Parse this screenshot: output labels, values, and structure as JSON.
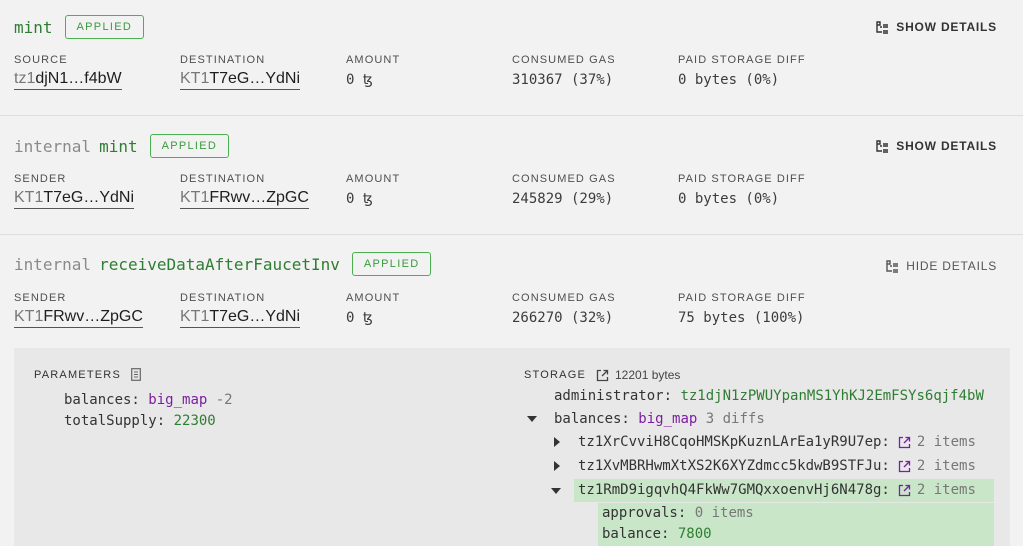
{
  "ops": [
    {
      "internal": "",
      "entrypoint": "mint",
      "status": "APPLIED",
      "toggle": "SHOW DETAILS",
      "from_label": "SOURCE",
      "from_prefix": "tz1",
      "from_addr": "djN1…f4bW",
      "to_label": "DESTINATION",
      "to_prefix": "KT1",
      "to_addr": "T7eG…YdNi",
      "amount_label": "AMOUNT",
      "amount": "0 ꜩ",
      "gas_label": "CONSUMED GAS",
      "gas": "310367 (37%)",
      "storage_label": "PAID STORAGE DIFF",
      "storage": "0 bytes (0%)"
    },
    {
      "internal": "internal",
      "entrypoint": "mint",
      "status": "APPLIED",
      "toggle": "SHOW DETAILS",
      "from_label": "SENDER",
      "from_prefix": "KT1",
      "from_addr": "T7eG…YdNi",
      "to_label": "DESTINATION",
      "to_prefix": "KT1",
      "to_addr": "FRwv…ZpGC",
      "amount_label": "AMOUNT",
      "amount": "0 ꜩ",
      "gas_label": "CONSUMED GAS",
      "gas": "245829 (29%)",
      "storage_label": "PAID STORAGE DIFF",
      "storage": "0 bytes (0%)"
    },
    {
      "internal": "internal",
      "entrypoint": "receiveDataAfterFaucetInv",
      "status": "APPLIED",
      "toggle": "HIDE DETAILS",
      "from_label": "SENDER",
      "from_prefix": "KT1",
      "from_addr": "FRwv…ZpGC",
      "to_label": "DESTINATION",
      "to_prefix": "KT1",
      "to_addr": "T7eG…YdNi",
      "amount_label": "AMOUNT",
      "amount": "0 ꜩ",
      "gas_label": "CONSUMED GAS",
      "gas": "266270 (32%)",
      "storage_label": "PAID STORAGE DIFF",
      "storage": "75 bytes (100%)"
    }
  ],
  "parameters": {
    "label": "PARAMETERS",
    "balances_key": "balances:",
    "balances_type": "big_map",
    "balances_val": "-2",
    "total_key": "totalSupply:",
    "total_val": "22300"
  },
  "storage": {
    "label": "STORAGE",
    "size": "12201 bytes",
    "admin_key": "administrator:",
    "admin_val": "tz1djN1zPWUYpanMS1YhKJ2EmFSYs6qjf4bW",
    "balances_key": "balances:",
    "balances_type": "big_map",
    "balances_diffs": "3 diffs",
    "entries": [
      {
        "key": "tz1XrCvviH8CqoHMSKpKuznLArEa1yR9U7ep:",
        "count": "2 items"
      },
      {
        "key": "tz1XvMBRHwmXtXS2K6XYZdmcc5kdwB9STFJu:",
        "count": "2 items"
      },
      {
        "key": "tz1RmD9igqvhQ4FkWw7GMQxxoenvHj6N478g:",
        "count": "2 items"
      }
    ],
    "approvals_key": "approvals:",
    "approvals_val": "0 items",
    "balance_key": "balance:",
    "balance_val": "7800"
  },
  "colors": {
    "applied": "#4caf50",
    "entrypoint": "#2f7d32",
    "type": "#7b1fa2",
    "highlight": "#c9e6c9"
  }
}
